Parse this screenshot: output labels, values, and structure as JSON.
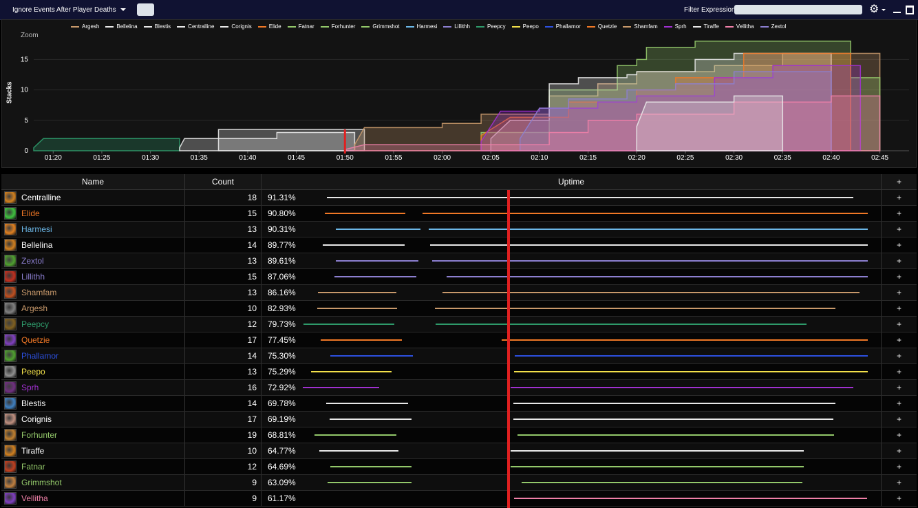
{
  "topbar": {
    "dropdown_label": "Ignore Events After Player Deaths",
    "filter_label": "Filter Expression:",
    "filter_value": "",
    "icons": [
      "gear-icon",
      "minimize-icon",
      "maximize-icon"
    ]
  },
  "chart": {
    "zoom_label": "Zoom",
    "ylabel": "Stacks"
  },
  "chart_data": {
    "type": "area",
    "ylabel": "Stacks",
    "ylim": [
      0,
      19
    ],
    "yticks": [
      0,
      5,
      10,
      15
    ],
    "xlim": [
      78,
      168
    ],
    "xticks": [
      "01:20",
      "01:25",
      "01:30",
      "01:35",
      "01:40",
      "01:45",
      "01:50",
      "01:55",
      "02:00",
      "02:05",
      "02:10",
      "02:15",
      "02:20",
      "02:25",
      "02:30",
      "02:35",
      "02:40",
      "02:45"
    ],
    "xtick_values": [
      80,
      85,
      90,
      95,
      100,
      105,
      110,
      115,
      120,
      125,
      130,
      135,
      140,
      145,
      150,
      155,
      160,
      165
    ],
    "grid": true,
    "legend_position": "top",
    "cursor_x": "01:50",
    "series": [
      {
        "name": "Argesh",
        "color": "#c8996b"
      },
      {
        "name": "Bellelina",
        "color": "#e8e8e8"
      },
      {
        "name": "Blestis",
        "color": "#e8e8e8"
      },
      {
        "name": "Centralline",
        "color": "#e8e8e8"
      },
      {
        "name": "Corignis",
        "color": "#e8e8e8"
      },
      {
        "name": "Elide",
        "color": "#f07826"
      },
      {
        "name": "Fatnar",
        "color": "#93c86a"
      },
      {
        "name": "Forhunter",
        "color": "#93c86a"
      },
      {
        "name": "Grimmshot",
        "color": "#93c86a"
      },
      {
        "name": "Harmesi",
        "color": "#6cb8e8"
      },
      {
        "name": "Lillithh",
        "color": "#8c7fd0"
      },
      {
        "name": "Peepcy",
        "color": "#2e9a6a"
      },
      {
        "name": "Peepo",
        "color": "#f2e04a"
      },
      {
        "name": "Phallamor",
        "color": "#2c50e0"
      },
      {
        "name": "Quetzie",
        "color": "#f07826"
      },
      {
        "name": "Shamfam",
        "color": "#c8996b"
      },
      {
        "name": "Sprh",
        "color": "#a030d0"
      },
      {
        "name": "Tiraffe",
        "color": "#e8e8e8"
      },
      {
        "name": "Vellitha",
        "color": "#f080a8"
      },
      {
        "name": "Zextol",
        "color": "#8c7fd0"
      }
    ],
    "steps": [
      {
        "color": "#2e9a6a",
        "points": [
          [
            78,
            0.5
          ],
          [
            79,
            2
          ],
          [
            93,
            2
          ],
          [
            93,
            0
          ]
        ]
      },
      {
        "color": "#e8e8e8",
        "points": [
          [
            93,
            0.5
          ],
          [
            93.5,
            2
          ],
          [
            103,
            2
          ],
          [
            103,
            3
          ],
          [
            111,
            3
          ],
          [
            111,
            0
          ]
        ]
      },
      {
        "color": "#e8e8e8",
        "points": [
          [
            97,
            0
          ],
          [
            97,
            3.5
          ],
          [
            112,
            3.5
          ],
          [
            112,
            0
          ]
        ]
      },
      {
        "color": "#c8996b",
        "points": [
          [
            111,
            1
          ],
          [
            112,
            3.8
          ],
          [
            120,
            3.8
          ],
          [
            120,
            4.5
          ],
          [
            124,
            4.5
          ],
          [
            124,
            6
          ],
          [
            131,
            6
          ],
          [
            131,
            9
          ],
          [
            136,
            9
          ],
          [
            136,
            11
          ],
          [
            140,
            11
          ],
          [
            140,
            13
          ],
          [
            148,
            13
          ],
          [
            148,
            14
          ],
          [
            155,
            14
          ],
          [
            155,
            16
          ],
          [
            165,
            16
          ],
          [
            165,
            0
          ]
        ]
      },
      {
        "color": "#93c86a",
        "points": [
          [
            124,
            1
          ],
          [
            124,
            3
          ],
          [
            131,
            3
          ],
          [
            131,
            10
          ],
          [
            138,
            10
          ],
          [
            138,
            14
          ],
          [
            140,
            14
          ],
          [
            140,
            15
          ],
          [
            141,
            15
          ],
          [
            141,
            17
          ],
          [
            146,
            17
          ],
          [
            146,
            18
          ],
          [
            162,
            18
          ],
          [
            162,
            12
          ],
          [
            165,
            12
          ],
          [
            165,
            0
          ]
        ]
      },
      {
        "color": "#e8e8e8",
        "points": [
          [
            125,
            2
          ],
          [
            127,
            5
          ],
          [
            131,
            5
          ],
          [
            131,
            11
          ],
          [
            134,
            11
          ],
          [
            134,
            12
          ],
          [
            139,
            12
          ],
          [
            139,
            12.5
          ],
          [
            140,
            12.5
          ],
          [
            140,
            13
          ],
          [
            146,
            13
          ],
          [
            146,
            15
          ],
          [
            150,
            15
          ],
          [
            150,
            16
          ],
          [
            160,
            16
          ],
          [
            160,
            0
          ]
        ]
      },
      {
        "color": "#f07826",
        "points": [
          [
            124,
            2.5
          ],
          [
            127,
            5.5
          ],
          [
            133,
            5.5
          ],
          [
            133,
            8
          ],
          [
            140,
            8
          ],
          [
            140,
            10
          ],
          [
            144,
            10
          ],
          [
            144,
            12
          ],
          [
            151,
            12
          ],
          [
            151,
            16
          ],
          [
            162,
            16
          ],
          [
            162,
            0
          ]
        ]
      },
      {
        "color": "#a030d0",
        "points": [
          [
            124,
            1.5
          ],
          [
            126,
            6.5
          ],
          [
            130,
            6.5
          ],
          [
            130,
            7
          ],
          [
            136,
            7
          ],
          [
            136,
            8
          ],
          [
            140,
            8
          ],
          [
            140,
            9
          ],
          [
            148,
            9
          ],
          [
            148,
            12
          ],
          [
            154,
            12
          ],
          [
            154,
            14
          ],
          [
            163,
            14
          ],
          [
            163,
            0
          ]
        ]
      },
      {
        "color": "#8c7fd0",
        "points": [
          [
            128,
            2
          ],
          [
            130,
            7
          ],
          [
            133,
            7
          ],
          [
            133,
            8.5
          ],
          [
            139,
            8.5
          ],
          [
            139,
            10
          ],
          [
            144,
            10
          ],
          [
            144,
            11
          ],
          [
            150,
            11
          ],
          [
            150,
            13
          ],
          [
            160,
            13
          ],
          [
            160,
            0
          ]
        ]
      },
      {
        "color": "#f080a8",
        "points": [
          [
            110,
            0.2
          ],
          [
            112,
            1
          ],
          [
            131,
            1
          ],
          [
            131,
            3
          ],
          [
            135,
            3
          ],
          [
            135,
            5
          ],
          [
            140,
            5
          ],
          [
            140,
            6
          ],
          [
            150,
            6
          ],
          [
            150,
            8
          ],
          [
            160,
            8
          ],
          [
            160,
            9
          ],
          [
            165,
            9
          ],
          [
            165,
            0
          ]
        ]
      },
      {
        "color": "#e8e8e8",
        "points": [
          [
            140,
            4
          ],
          [
            141,
            8
          ],
          [
            150,
            8
          ],
          [
            150,
            9
          ],
          [
            155,
            9
          ],
          [
            155,
            0
          ]
        ]
      }
    ]
  },
  "table": {
    "headers": {
      "name": "Name",
      "count": "Count",
      "uptime": "Uptime",
      "plus": "+"
    },
    "plus_label": "+",
    "rows": [
      {
        "name": "Centralline",
        "color": "#ffffff",
        "icon": "#d08020",
        "count": "18",
        "pct": "91.31%",
        "bars": [
          [
            0.105,
            0.955
          ]
        ]
      },
      {
        "name": "Elide",
        "color": "#f07826",
        "icon": "#40c040",
        "count": "15",
        "pct": "90.80%",
        "bars": [
          [
            0.102,
            0.232
          ],
          [
            0.26,
            0.978
          ]
        ]
      },
      {
        "name": "Harmesi",
        "color": "#6cb8e8",
        "icon": "#e08020",
        "count": "13",
        "pct": "90.31%",
        "bars": [
          [
            0.12,
            0.256
          ],
          [
            0.27,
            0.978
          ]
        ]
      },
      {
        "name": "Bellelina",
        "color": "#ffffff",
        "icon": "#d08020",
        "count": "14",
        "pct": "89.77%",
        "bars": [
          [
            0.099,
            0.231
          ],
          [
            0.272,
            0.978
          ]
        ]
      },
      {
        "name": "Zextol",
        "color": "#8c7fd0",
        "icon": "#50a030",
        "count": "13",
        "pct": "89.61%",
        "bars": [
          [
            0.12,
            0.253
          ],
          [
            0.275,
            0.978
          ]
        ]
      },
      {
        "name": "Lillithh",
        "color": "#8c7fd0",
        "icon": "#c03020",
        "count": "15",
        "pct": "87.06%",
        "bars": [
          [
            0.118,
            0.25
          ],
          [
            0.299,
            0.978
          ]
        ]
      },
      {
        "name": "Shamfam",
        "color": "#c8996b",
        "icon": "#c05020",
        "count": "13",
        "pct": "86.16%",
        "bars": [
          [
            0.091,
            0.217
          ],
          [
            0.292,
            0.965
          ]
        ]
      },
      {
        "name": "Argesh",
        "color": "#c8996b",
        "icon": "#808080",
        "count": "10",
        "pct": "82.93%",
        "bars": [
          [
            0.09,
            0.219
          ],
          [
            0.28,
            0.926
          ]
        ]
      },
      {
        "name": "Peepcy",
        "color": "#2e9a6a",
        "icon": "#806020",
        "count": "12",
        "pct": "79.73%",
        "bars": [
          [
            0.068,
            0.214
          ],
          [
            0.281,
            0.879
          ]
        ]
      },
      {
        "name": "Quetzie",
        "color": "#f07826",
        "icon": "#8040c0",
        "count": "17",
        "pct": "77.45%",
        "bars": [
          [
            0.095,
            0.226
          ],
          [
            0.387,
            0.978
          ]
        ]
      },
      {
        "name": "Phallamor",
        "color": "#2c50e0",
        "icon": "#50a030",
        "count": "14",
        "pct": "75.30%",
        "bars": [
          [
            0.111,
            0.244
          ],
          [
            0.408,
            0.978
          ]
        ]
      },
      {
        "name": "Peepo",
        "color": "#f2e04a",
        "icon": "#909090",
        "count": "13",
        "pct": "75.29%",
        "bars": [
          [
            0.08,
            0.21
          ],
          [
            0.407,
            0.978
          ]
        ]
      },
      {
        "name": "Sprh",
        "color": "#a030d0",
        "icon": "#703080",
        "count": "16",
        "pct": "72.92%",
        "bars": [
          [
            0.066,
            0.19
          ],
          [
            0.402,
            0.955
          ]
        ]
      },
      {
        "name": "Blestis",
        "color": "#ffffff",
        "icon": "#4080c0",
        "count": "14",
        "pct": "69.78%",
        "bars": [
          [
            0.104,
            0.237
          ],
          [
            0.406,
            0.926
          ]
        ]
      },
      {
        "name": "Corignis",
        "color": "#ffffff",
        "icon": "#c09080",
        "count": "17",
        "pct": "69.19%",
        "bars": [
          [
            0.11,
            0.242
          ],
          [
            0.406,
            0.922
          ]
        ]
      },
      {
        "name": "Forhunter",
        "color": "#93c86a",
        "icon": "#c08030",
        "count": "19",
        "pct": "68.81%",
        "bars": [
          [
            0.085,
            0.218
          ],
          [
            0.413,
            0.924
          ]
        ]
      },
      {
        "name": "Tiraffe",
        "color": "#ffffff",
        "icon": "#d08020",
        "count": "10",
        "pct": "64.77%",
        "bars": [
          [
            0.093,
            0.221
          ],
          [
            0.402,
            0.875
          ]
        ]
      },
      {
        "name": "Fatnar",
        "color": "#93c86a",
        "icon": "#c04020",
        "count": "12",
        "pct": "64.69%",
        "bars": [
          [
            0.111,
            0.242
          ],
          [
            0.402,
            0.875
          ]
        ]
      },
      {
        "name": "Grimmshot",
        "color": "#93c86a",
        "icon": "#c08040",
        "count": "9",
        "pct": "63.09%",
        "bars": [
          [
            0.107,
            0.242
          ],
          [
            0.419,
            0.872
          ]
        ]
      },
      {
        "name": "Vellitha",
        "color": "#f080a8",
        "icon": "#8040c0",
        "count": "9",
        "pct": "61.17%",
        "bars": [
          [
            0.407,
            0.977
          ]
        ]
      }
    ]
  }
}
